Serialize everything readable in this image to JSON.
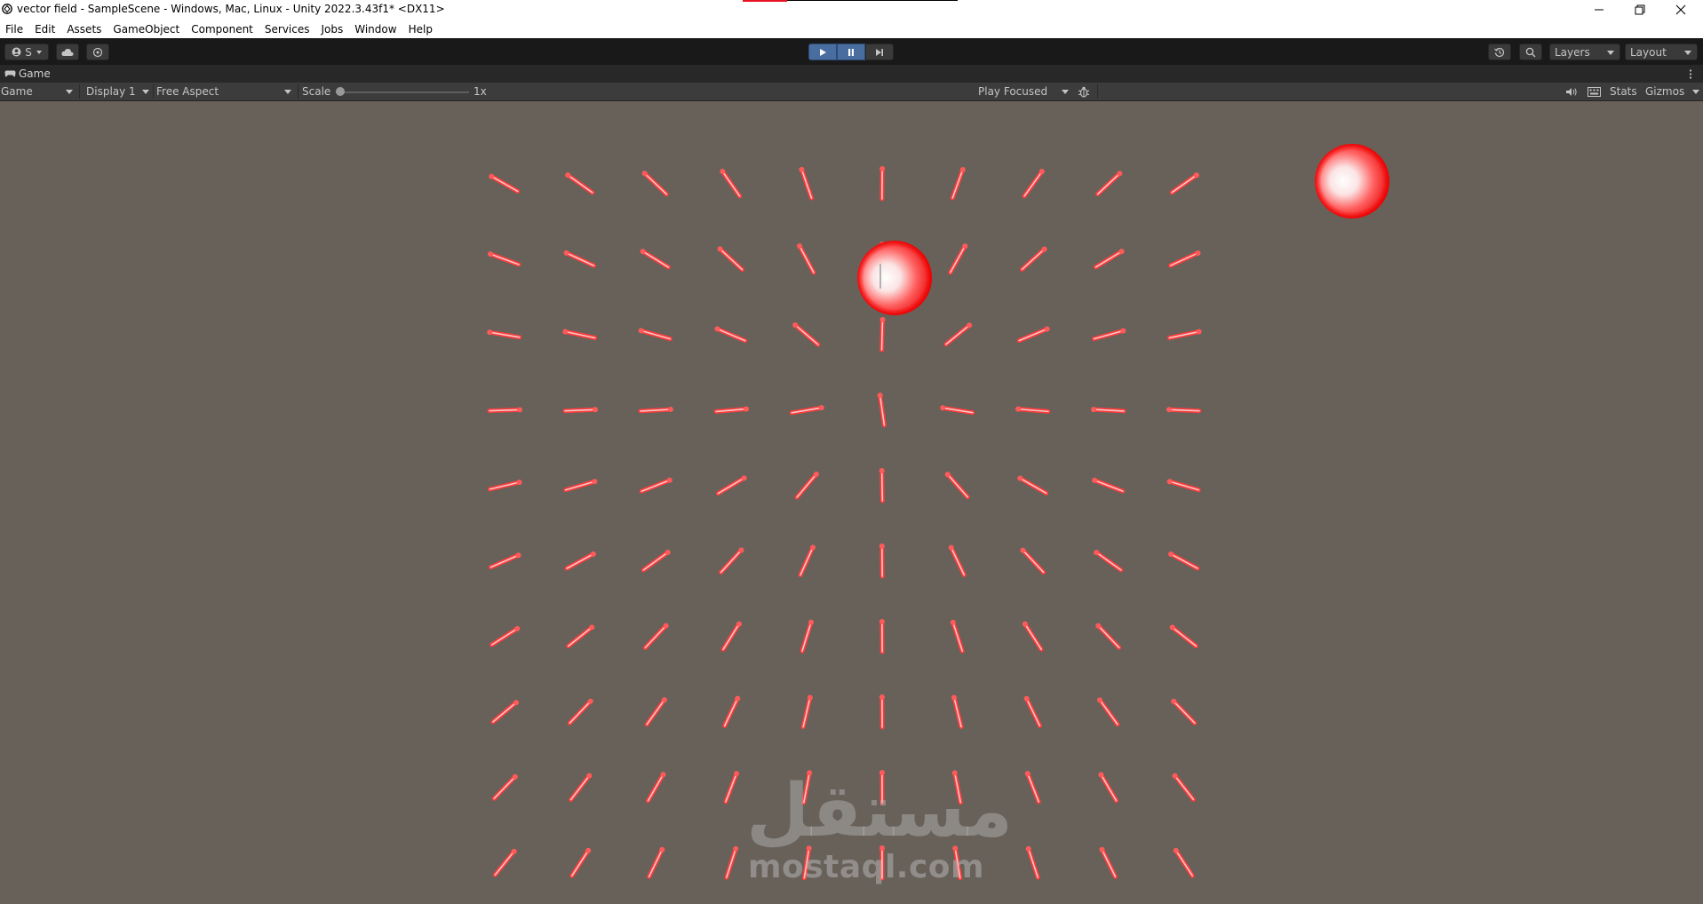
{
  "window": {
    "title": "vector field - SampleScene - Windows, Mac, Linux - Unity 2022.3.43f1* <DX11>",
    "minimize_icon": "minimize-icon",
    "maximize_icon": "restore-icon",
    "close_icon": "close-icon"
  },
  "menu": {
    "items": [
      "File",
      "Edit",
      "Assets",
      "GameObject",
      "Component",
      "Services",
      "Jobs",
      "Window",
      "Help"
    ]
  },
  "toolbar": {
    "account_label": "S",
    "cloud_icon": "cloud-icon",
    "collab_icon": "collab-icon",
    "play_icon": "play-icon",
    "pause_icon": "pause-icon",
    "step_icon": "step-icon",
    "history_icon": "history-icon",
    "search_icon": "search-icon",
    "layers_label": "Layers",
    "layout_label": "Layout",
    "play_active_color": "#4a6da0"
  },
  "game_view": {
    "tab_label": "Game",
    "view_mode": "Game",
    "display": "Display 1",
    "aspect": "Free Aspect",
    "scale_label": "Scale",
    "scale_value": "1x",
    "play_mode": "Play Focused",
    "stats_label": "Stats",
    "gizmos_label": "Gizmos",
    "background_color": "#68615a",
    "arrow_color": "#ff3b3b",
    "sphere_color": "#ff0000"
  },
  "scene": {
    "sphere_count": 2,
    "grid_rows": 10,
    "grid_cols": 10
  },
  "watermark": {
    "arabic": "مستقل",
    "latin": "mostaql.com"
  }
}
